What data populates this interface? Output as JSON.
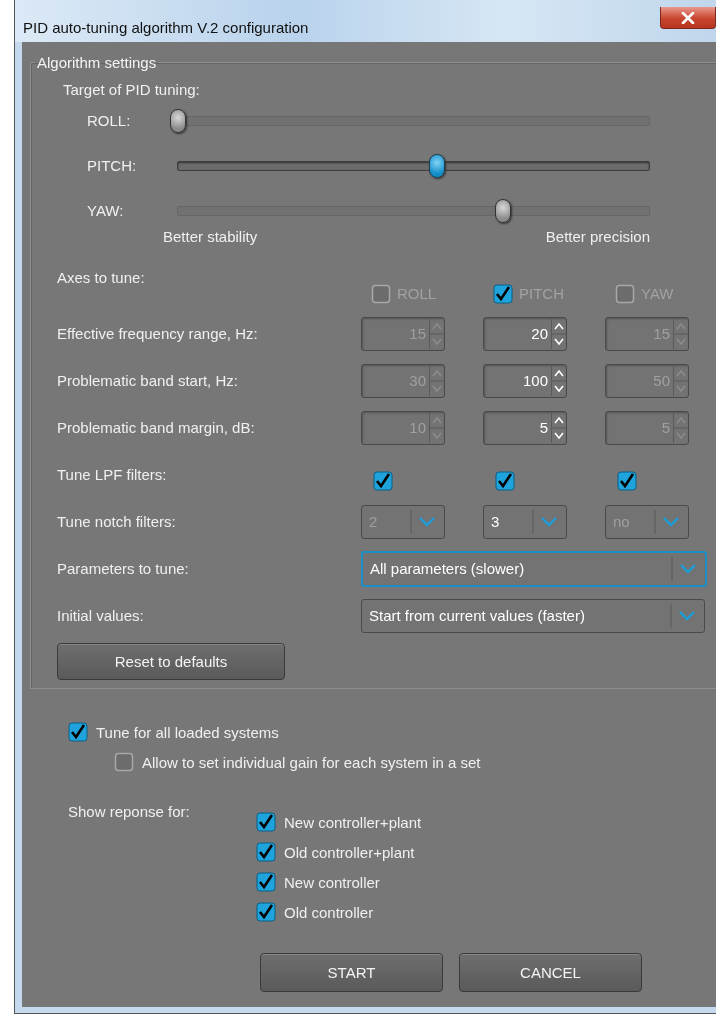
{
  "window": {
    "title": "PID auto-tuning algorithm V.2 configuration"
  },
  "algorithm_settings": {
    "title": "Algorithm settings",
    "target_label": "Target of PID tuning:",
    "sliders": [
      {
        "label": "ROLL:",
        "level": 0,
        "disabled": true
      },
      {
        "label": "PITCH:",
        "level": 0.55,
        "disabled": false
      },
      {
        "label": "YAW:",
        "level": 0.69,
        "disabled": true
      }
    ],
    "scale_min": "Better stability",
    "scale_max": "Better precision",
    "axes": {
      "label": "Axes to tune:",
      "options": [
        {
          "label": "ROLL",
          "checked": false,
          "disabled": true
        },
        {
          "label": "PITCH",
          "checked": true,
          "disabled": true
        },
        {
          "label": "YAW",
          "checked": false,
          "disabled": true
        }
      ]
    },
    "spin_rows": [
      {
        "label": "Effective frequency range, Hz:",
        "fields": [
          {
            "value": "15",
            "disabled": true
          },
          {
            "value": "20",
            "disabled": false
          },
          {
            "value": "15",
            "disabled": true
          }
        ]
      },
      {
        "label": "Problematic band start, Hz:",
        "fields": [
          {
            "value": "30",
            "disabled": true
          },
          {
            "value": "100",
            "disabled": false
          },
          {
            "value": "50",
            "disabled": true
          }
        ]
      },
      {
        "label": "Problematic band margin, dB:",
        "fields": [
          {
            "value": "10",
            "disabled": true
          },
          {
            "value": "5",
            "disabled": false
          },
          {
            "value": "5",
            "disabled": true
          }
        ]
      }
    ],
    "lpf": {
      "label": "Tune LPF filters:",
      "checks": [
        {
          "checked": true
        },
        {
          "checked": true
        },
        {
          "checked": true
        }
      ]
    },
    "notch": {
      "label": "Tune notch filters:",
      "dropdowns": [
        {
          "value": "2",
          "disabled": true
        },
        {
          "value": "3",
          "disabled": false
        },
        {
          "value": "no",
          "disabled": true
        }
      ]
    },
    "selects": [
      {
        "label": "Parameters to tune:",
        "value": "All parameters (slower)",
        "focused": true
      },
      {
        "label": "Initial values:",
        "value": "Start from current values (faster)",
        "focused": false
      }
    ],
    "reset_button": "Reset to defaults"
  },
  "tune_all": {
    "label": "Tune for all loaded systems",
    "checked": true,
    "children": [
      {
        "label": "Allow to set individual gain for each system in a set",
        "checked": false
      }
    ]
  },
  "show_response": {
    "label": "Show reponse for:",
    "options": [
      {
        "label": "New controller+plant",
        "checked": true
      },
      {
        "label": "Old controller+plant",
        "checked": true
      },
      {
        "label": "New controller",
        "checked": true
      },
      {
        "label": "Old controller",
        "checked": true
      }
    ]
  },
  "buttons": [
    "START",
    "CANCEL"
  ]
}
